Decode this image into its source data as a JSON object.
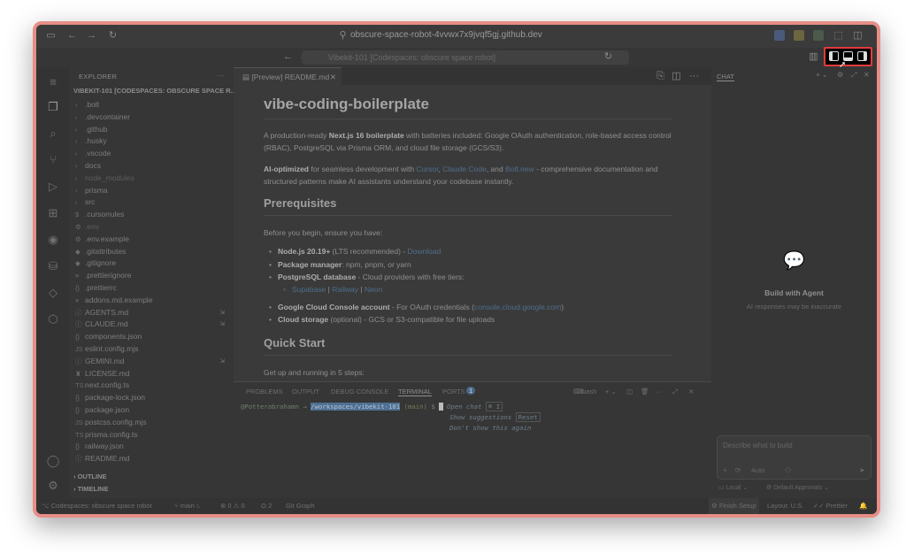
{
  "browser": {
    "url": "obscure-space-robot-4vvwx7x9jvqf5gj.github.dev"
  },
  "titlebar": {
    "search": "Vibekit-101 [Codespaces: obscure space robot]"
  },
  "explorer": {
    "title": "EXPLORER",
    "root": "VIBEKIT-101 [CODESPACES: OBSCURE SPACE R...",
    "items": [
      {
        "name": ".bolt",
        "type": "folder"
      },
      {
        "name": ".devcontainer",
        "type": "folder"
      },
      {
        "name": ".github",
        "type": "folder"
      },
      {
        "name": ".husky",
        "type": "folder"
      },
      {
        "name": ".vscode",
        "type": "folder"
      },
      {
        "name": "docs",
        "type": "folder"
      },
      {
        "name": "node_modules",
        "type": "folder",
        "dim": true
      },
      {
        "name": "prisma",
        "type": "folder"
      },
      {
        "name": "src",
        "type": "folder"
      },
      {
        "name": ".cursorrules",
        "type": "file",
        "icon": "$"
      },
      {
        "name": ".env",
        "type": "file",
        "icon": "⚙",
        "dim": true
      },
      {
        "name": ".env.example",
        "type": "file",
        "icon": "⚙"
      },
      {
        "name": ".gitattributes",
        "type": "file",
        "icon": "◆"
      },
      {
        "name": ".gitignore",
        "type": "file",
        "icon": "◆"
      },
      {
        "name": ".prettierignore",
        "type": "file",
        "icon": "≡"
      },
      {
        "name": ".prettierrc",
        "type": "file",
        "icon": "{}"
      },
      {
        "name": "addons.md.example",
        "type": "file",
        "icon": "≡"
      },
      {
        "name": "AGENTS.md",
        "type": "file",
        "icon": "ⓘ",
        "badge": "⇲"
      },
      {
        "name": "CLAUDE.md",
        "type": "file",
        "icon": "ⓘ",
        "badge": "⇲"
      },
      {
        "name": "components.json",
        "type": "file",
        "icon": "{}"
      },
      {
        "name": "eslint.config.mjs",
        "type": "file",
        "icon": "JS"
      },
      {
        "name": "GEMINI.md",
        "type": "file",
        "icon": "ⓘ",
        "badge": "⇲"
      },
      {
        "name": "LICENSE.md",
        "type": "file",
        "icon": "♜"
      },
      {
        "name": "next.config.ts",
        "type": "file",
        "icon": "TS"
      },
      {
        "name": "package-lock.json",
        "type": "file",
        "icon": "{}"
      },
      {
        "name": "package.json",
        "type": "file",
        "icon": "{}"
      },
      {
        "name": "postcss.config.mjs",
        "type": "file",
        "icon": "JS"
      },
      {
        "name": "prisma.config.ts",
        "type": "file",
        "icon": "TS"
      },
      {
        "name": "railway.json",
        "type": "file",
        "icon": "{}"
      },
      {
        "name": "README.md",
        "type": "file",
        "icon": "ⓘ"
      }
    ],
    "outline": "OUTLINE",
    "timeline": "TIMELINE"
  },
  "editor": {
    "tab_label": "[Preview] README.md",
    "h1": "vibe-coding-boilerplate",
    "intro_pre": "A production-ready ",
    "intro_bold": "Next.js 16 boilerplate",
    "intro_post": " with batteries included: Google OAuth authentication, role-based access control (RBAC), PostgreSQL via Prisma ORM, and cloud file storage (GCS/S3).",
    "ai_bold": "AI-optimized",
    "ai_pre": " for seamless development with ",
    "ai_link1": "Cursor",
    "ai_link2": "Claude Code",
    "ai_and": ", and ",
    "ai_link3": "Bolt.new",
    "ai_post": " - comprehensive documentation and structured patterns make AI assistants understand your codebase instantly.",
    "h2_prereq": "Prerequisites",
    "prereq_intro": "Before you begin, ensure you have:",
    "li1_bold": "Node.js 20.19+",
    "li1_text": " (LTS recommended) - ",
    "li1_link": "Download",
    "li2_bold": "Package manager",
    "li2_text": ": npm, pnpm, or yarn",
    "li3_bold": "PostgreSQL database",
    "li3_text": " - Cloud providers with free tiers:",
    "sub_link1": "Supabase",
    "sub_link2": "Railway",
    "sub_link3": "Neon",
    "sub_sep": " | ",
    "li4_bold": "Google Cloud Console account",
    "li4_text": " - For OAuth credentials (",
    "li4_link": "console.cloud.google.com",
    "li4_end": ")",
    "li5_bold": "Cloud storage",
    "li5_text": " (optional) - GCS or S3-compatible for file uploads",
    "h2_quick": "Quick Start",
    "quick_intro": "Get up and running in 5 steps:"
  },
  "panel": {
    "tabs": [
      "PROBLEMS",
      "OUTPUT",
      "DEBUG CONSOLE",
      "TERMINAL",
      "PORTS"
    ],
    "ports_count": "1",
    "shell": "bash",
    "prompt_user": "@Potterabrahamn",
    "prompt_arrow": "→",
    "prompt_path": "/workspaces/vibekit-101",
    "prompt_branch": "(main)",
    "prompt_symbol": "$",
    "hint1": "Open chat",
    "hint1_key": "⌘ I",
    "hint2": "Show suggestions",
    "hint2_key": "Reset",
    "hint3": "Don't show this again"
  },
  "chat": {
    "title": "CHAT",
    "heading": "Build with Agent",
    "subtext": "AI responses may be inaccurate",
    "input_placeholder": "Describe what to build",
    "mode": "Auto",
    "local": "Local",
    "approvals": "Default Approvals"
  },
  "status": {
    "remote": "Codespaces: obscure space robot",
    "branch": "main",
    "errors": "0",
    "warnings": "0",
    "ports": "2",
    "git_graph": "Git Graph",
    "layout": "Layout: U.S.",
    "finish_setup": "Finish Setup",
    "prettier": "Prettier"
  }
}
